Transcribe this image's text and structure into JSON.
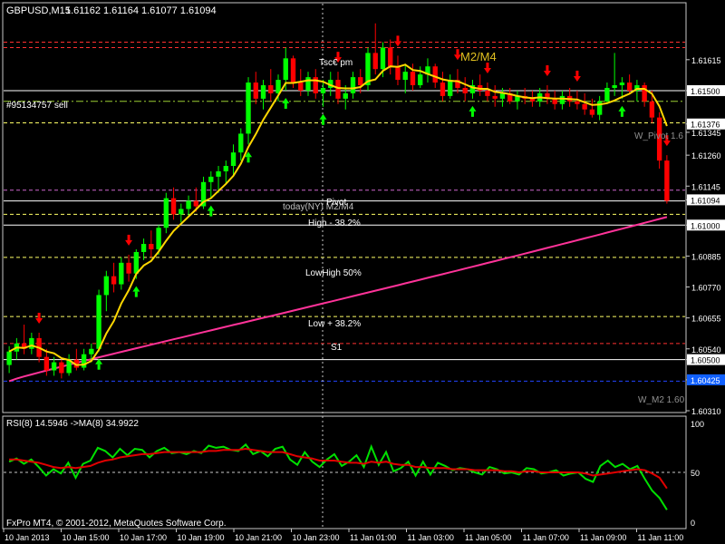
{
  "window": {
    "symbol_header": "GBPUSD,M15",
    "ohlc_header": "1.61162 1.61164 1.61077 1.61094",
    "order_label": "#95134757 sell",
    "copyright": "FxPro MT4, © 2001-2012, MetaQuotes Software Corp."
  },
  "annotations": {
    "m2m4": "M2/M4",
    "tsgroup": "Tsc€ pm",
    "today_pivot": "today(NY)  M2/M4",
    "pivot": "Pivot",
    "high_382": "High - 38.2%",
    "lowhigh_50": "LowHigh 50%",
    "low_382": "Low + 38.2%",
    "s1": "S1",
    "w_pivot": "W_Pivot 1.6",
    "w_m2": "W_M2 1.60"
  },
  "colors": {
    "background": "#000000",
    "bull": "#00ff00",
    "bear": "#ff0000",
    "ma_fast": "#ffd700",
    "ma_slow": "#ff3399",
    "rsi": "#00e000",
    "rsi_ma": "#e00000",
    "grid_white": "#ffffff",
    "level_red": "#ff3030",
    "level_green": "#9acd32",
    "axis_tag_bg": "#ffffff",
    "axis_tag_blue": "#1060ff"
  },
  "chart_data": {
    "type": "candlestick",
    "price_axis": {
      "ticks": [
        "1.61615",
        "1.61500",
        "1.61376",
        "1.61345",
        "1.61260",
        "1.61145",
        "1.61094",
        "1.61000",
        "1.60885",
        "1.60770",
        "1.60655",
        "1.60540",
        "1.60500",
        "1.60425",
        "1.60310"
      ],
      "tagged": [
        {
          "label": "1.61500",
          "style": "white"
        },
        {
          "label": "1.61376",
          "style": "white"
        },
        {
          "label": "1.61094",
          "style": "white"
        },
        {
          "label": "1.61000",
          "style": "white"
        },
        {
          "label": "1.60500",
          "style": "white"
        },
        {
          "label": "1.60425",
          "style": "blue"
        }
      ],
      "ylim": [
        1.6031,
        1.6182
      ]
    },
    "time_axis": [
      "10 Jan 2013",
      "10 Jan 15:00",
      "10 Jan 17:00",
      "10 Jan 19:00",
      "10 Jan 21:00",
      "10 Jan 23:00",
      "11 Jan 01:00",
      "11 Jan 03:00",
      "11 Jan 05:00",
      "11 Jan 07:00",
      "11 Jan 09:00",
      "11 Jan 11:00"
    ],
    "price_level_lines": [
      {
        "price": 1.6168,
        "style": "dashed",
        "color": "#ff3030"
      },
      {
        "price": 1.6166,
        "style": "dashed",
        "color": "#ff3030"
      },
      {
        "price": 1.615,
        "style": "solid",
        "color": "#ffffff"
      },
      {
        "price": 1.6146,
        "style": "dashdot",
        "color": "#9acd32"
      },
      {
        "price": 1.6138,
        "style": "dashed",
        "color": "#ffff66"
      },
      {
        "price": 1.6109,
        "style": "solid",
        "color": "#ffffff"
      },
      {
        "price": 1.6113,
        "style": "dashed",
        "color": "#cc66cc"
      },
      {
        "price": 1.6104,
        "style": "dashed",
        "color": "#ffff66"
      },
      {
        "price": 1.61,
        "style": "solid",
        "color": "#ffffff"
      },
      {
        "price": 1.6088,
        "style": "dashed",
        "color": "#ffff66"
      },
      {
        "price": 1.6066,
        "style": "dashed",
        "color": "#ffff66"
      },
      {
        "price": 1.6056,
        "style": "dashed",
        "color": "#ff3030"
      },
      {
        "price": 1.605,
        "style": "solid",
        "color": "#ffffff"
      },
      {
        "price": 1.6042,
        "style": "dashed",
        "color": "#2244ff"
      }
    ],
    "candles": [
      [
        1.6048,
        1.6055,
        1.6045,
        1.6053
      ],
      [
        1.6053,
        1.6058,
        1.605,
        1.6056
      ],
      [
        1.6056,
        1.6063,
        1.6052,
        1.6054
      ],
      [
        1.6054,
        1.606,
        1.6052,
        1.6058
      ],
      [
        1.6058,
        1.606,
        1.6049,
        1.6051
      ],
      [
        1.6051,
        1.6054,
        1.6044,
        1.6046
      ],
      [
        1.6046,
        1.6051,
        1.6044,
        1.6049
      ],
      [
        1.6049,
        1.605,
        1.6043,
        1.6045
      ],
      [
        1.6045,
        1.6052,
        1.6044,
        1.605
      ],
      [
        1.605,
        1.6054,
        1.6046,
        1.6047
      ],
      [
        1.6047,
        1.6054,
        1.6046,
        1.6052
      ],
      [
        1.6052,
        1.6056,
        1.6049,
        1.6054
      ],
      [
        1.6054,
        1.6076,
        1.6053,
        1.6074
      ],
      [
        1.6074,
        1.6083,
        1.6068,
        1.6081
      ],
      [
        1.6081,
        1.6086,
        1.6075,
        1.6078
      ],
      [
        1.6078,
        1.6088,
        1.6076,
        1.6086
      ],
      [
        1.6086,
        1.6089,
        1.6079,
        1.6082
      ],
      [
        1.6082,
        1.6091,
        1.608,
        1.609
      ],
      [
        1.609,
        1.6095,
        1.6087,
        1.6093
      ],
      [
        1.6093,
        1.6098,
        1.6088,
        1.6091
      ],
      [
        1.6091,
        1.61,
        1.6089,
        1.6099
      ],
      [
        1.6099,
        1.6112,
        1.6097,
        1.611
      ],
      [
        1.611,
        1.6114,
        1.6102,
        1.6104
      ],
      [
        1.6104,
        1.6108,
        1.6101,
        1.6106
      ],
      [
        1.6106,
        1.6111,
        1.6103,
        1.6109
      ],
      [
        1.6109,
        1.6114,
        1.6105,
        1.6107
      ],
      [
        1.6107,
        1.6118,
        1.6106,
        1.6116
      ],
      [
        1.6116,
        1.612,
        1.611,
        1.6118
      ],
      [
        1.6118,
        1.6122,
        1.6112,
        1.612
      ],
      [
        1.612,
        1.6124,
        1.6115,
        1.6122
      ],
      [
        1.6122,
        1.613,
        1.6118,
        1.6127
      ],
      [
        1.6127,
        1.6136,
        1.6124,
        1.6134
      ],
      [
        1.6134,
        1.6155,
        1.613,
        1.6153
      ],
      [
        1.6153,
        1.6157,
        1.6145,
        1.6147
      ],
      [
        1.6147,
        1.6154,
        1.6143,
        1.6152
      ],
      [
        1.6152,
        1.6158,
        1.6146,
        1.6149
      ],
      [
        1.6149,
        1.6156,
        1.6146,
        1.6154
      ],
      [
        1.6154,
        1.6166,
        1.615,
        1.6162
      ],
      [
        1.6162,
        1.6163,
        1.6151,
        1.6153
      ],
      [
        1.6153,
        1.6158,
        1.6148,
        1.615
      ],
      [
        1.615,
        1.6157,
        1.6148,
        1.6155
      ],
      [
        1.6155,
        1.6158,
        1.6147,
        1.6149
      ],
      [
        1.6149,
        1.6154,
        1.6144,
        1.6151
      ],
      [
        1.6151,
        1.6157,
        1.6148,
        1.6154
      ],
      [
        1.6154,
        1.6157,
        1.6145,
        1.6147
      ],
      [
        1.6147,
        1.6152,
        1.6143,
        1.6149
      ],
      [
        1.6149,
        1.6157,
        1.6147,
        1.6155
      ],
      [
        1.6155,
        1.6158,
        1.6149,
        1.6152
      ],
      [
        1.6152,
        1.6166,
        1.615,
        1.6164
      ],
      [
        1.6164,
        1.6175,
        1.6156,
        1.6158
      ],
      [
        1.6158,
        1.6168,
        1.6155,
        1.6166
      ],
      [
        1.6166,
        1.6169,
        1.6156,
        1.6159
      ],
      [
        1.6159,
        1.6163,
        1.6152,
        1.6154
      ],
      [
        1.6154,
        1.616,
        1.6149,
        1.6157
      ],
      [
        1.6157,
        1.616,
        1.615,
        1.6152
      ],
      [
        1.6152,
        1.6159,
        1.6151,
        1.6156
      ],
      [
        1.6156,
        1.6162,
        1.6153,
        1.6159
      ],
      [
        1.6159,
        1.616,
        1.6151,
        1.6153
      ],
      [
        1.6153,
        1.6157,
        1.6146,
        1.6148
      ],
      [
        1.6148,
        1.6156,
        1.6147,
        1.6154
      ],
      [
        1.6154,
        1.6158,
        1.6149,
        1.6151
      ],
      [
        1.6151,
        1.6155,
        1.6146,
        1.6149
      ],
      [
        1.6149,
        1.6154,
        1.6147,
        1.6152
      ],
      [
        1.6152,
        1.6156,
        1.6148,
        1.615
      ],
      [
        1.615,
        1.6153,
        1.6146,
        1.6148
      ],
      [
        1.6148,
        1.6152,
        1.6144,
        1.6147
      ],
      [
        1.6147,
        1.6151,
        1.6144,
        1.6149
      ],
      [
        1.6149,
        1.6151,
        1.6145,
        1.6146
      ],
      [
        1.6146,
        1.615,
        1.6143,
        1.6148
      ],
      [
        1.6148,
        1.6151,
        1.6145,
        1.6147
      ],
      [
        1.6147,
        1.615,
        1.6144,
        1.6146
      ],
      [
        1.6146,
        1.6151,
        1.6144,
        1.6149
      ],
      [
        1.6149,
        1.6152,
        1.6145,
        1.6147
      ],
      [
        1.6147,
        1.615,
        1.6143,
        1.6145
      ],
      [
        1.6145,
        1.615,
        1.6143,
        1.6148
      ],
      [
        1.6148,
        1.6151,
        1.6144,
        1.6146
      ],
      [
        1.6146,
        1.615,
        1.6143,
        1.6145
      ],
      [
        1.6145,
        1.6149,
        1.6141,
        1.6143
      ],
      [
        1.6143,
        1.6147,
        1.614,
        1.6141
      ],
      [
        1.6141,
        1.6148,
        1.6139,
        1.6146
      ],
      [
        1.6146,
        1.6153,
        1.6145,
        1.6151
      ],
      [
        1.6151,
        1.6164,
        1.6148,
        1.6152
      ],
      [
        1.6152,
        1.6155,
        1.6147,
        1.6153
      ],
      [
        1.6153,
        1.6156,
        1.6149,
        1.615
      ],
      [
        1.615,
        1.6154,
        1.6146,
        1.6152
      ],
      [
        1.6152,
        1.6153,
        1.6144,
        1.6146
      ],
      [
        1.6146,
        1.615,
        1.6138,
        1.614
      ],
      [
        1.614,
        1.6142,
        1.6121,
        1.6124
      ],
      [
        1.6124,
        1.6126,
        1.6108,
        1.6109
      ]
    ]
  },
  "rsi_panel": {
    "label": "RSI(8) 14.5946 ->MA(8) 34.9922",
    "ticks": [
      "100",
      "50",
      "0"
    ],
    "rsi_values": [
      60,
      63,
      58,
      62,
      55,
      47,
      53,
      49,
      59,
      45,
      58,
      61,
      73,
      70,
      64,
      72,
      66,
      72,
      71,
      64,
      70,
      73,
      68,
      69,
      67,
      70,
      68,
      75,
      73,
      74,
      71,
      70,
      76,
      67,
      70,
      65,
      72,
      74,
      62,
      57,
      69,
      60,
      55,
      62,
      67,
      56,
      60,
      66,
      55,
      74,
      57,
      69,
      51,
      54,
      60,
      47,
      60,
      48,
      59,
      56,
      52,
      54,
      53,
      50,
      48,
      55,
      53,
      49,
      50,
      48,
      54,
      53,
      49,
      50,
      52,
      47,
      49,
      50,
      44,
      41,
      56,
      61,
      55,
      58,
      53,
      56,
      44,
      33,
      26,
      15
    ],
    "ma_values": [
      62,
      62,
      61,
      60,
      59,
      57,
      55,
      54,
      55,
      54,
      55,
      56,
      59,
      61,
      62,
      64,
      65,
      66,
      67,
      67,
      68,
      69,
      69,
      69,
      69,
      69,
      69,
      70,
      70,
      71,
      71,
      71,
      72,
      71,
      70,
      69,
      69,
      69,
      67,
      65,
      64,
      63,
      61,
      61,
      61,
      60,
      59,
      59,
      58,
      60,
      59,
      60,
      58,
      57,
      57,
      55,
      55,
      54,
      54,
      54,
      53,
      53,
      53,
      52,
      52,
      52,
      52,
      51,
      51,
      50,
      51,
      51,
      50,
      50,
      50,
      50,
      50,
      50,
      49,
      47,
      48,
      49,
      50,
      51,
      52,
      53,
      52,
      49,
      45,
      35
    ]
  }
}
